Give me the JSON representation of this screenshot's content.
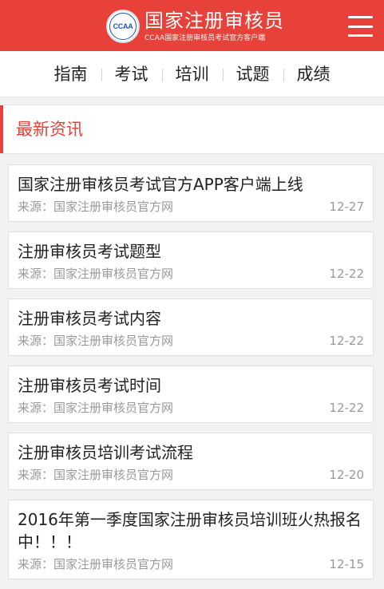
{
  "header": {
    "logo_text": "CCAA",
    "title": "国家注册审核员",
    "subtitle": "CCAA国家注册审核员考试官方客户端"
  },
  "nav": {
    "items": [
      {
        "label": "指南"
      },
      {
        "label": "考试"
      },
      {
        "label": "培训"
      },
      {
        "label": "试题"
      },
      {
        "label": "成绩"
      }
    ]
  },
  "section": {
    "title": "最新资讯"
  },
  "news": [
    {
      "title": "国家注册审核员考试官方APP客户端上线",
      "source": "来源：国家注册审核员官方网",
      "date": "12-27"
    },
    {
      "title": "注册审核员考试题型",
      "source": "来源：国家注册审核员官方网",
      "date": "12-22"
    },
    {
      "title": "注册审核员考试内容",
      "source": "来源：国家注册审核员官方网",
      "date": "12-22"
    },
    {
      "title": "注册审核员考试时间",
      "source": "来源：国家注册审核员官方网",
      "date": "12-22"
    },
    {
      "title": "注册审核员培训考试流程",
      "source": "来源：国家注册审核员官方网",
      "date": "12-20"
    },
    {
      "title": "2016年第一季度国家注册审核员培训班火热报名中！！！",
      "source": "来源：国家注册审核员官方网",
      "date": "12-15"
    }
  ],
  "colors": {
    "brand_red": "#e8413a",
    "logo_blue": "#1d57a6"
  }
}
